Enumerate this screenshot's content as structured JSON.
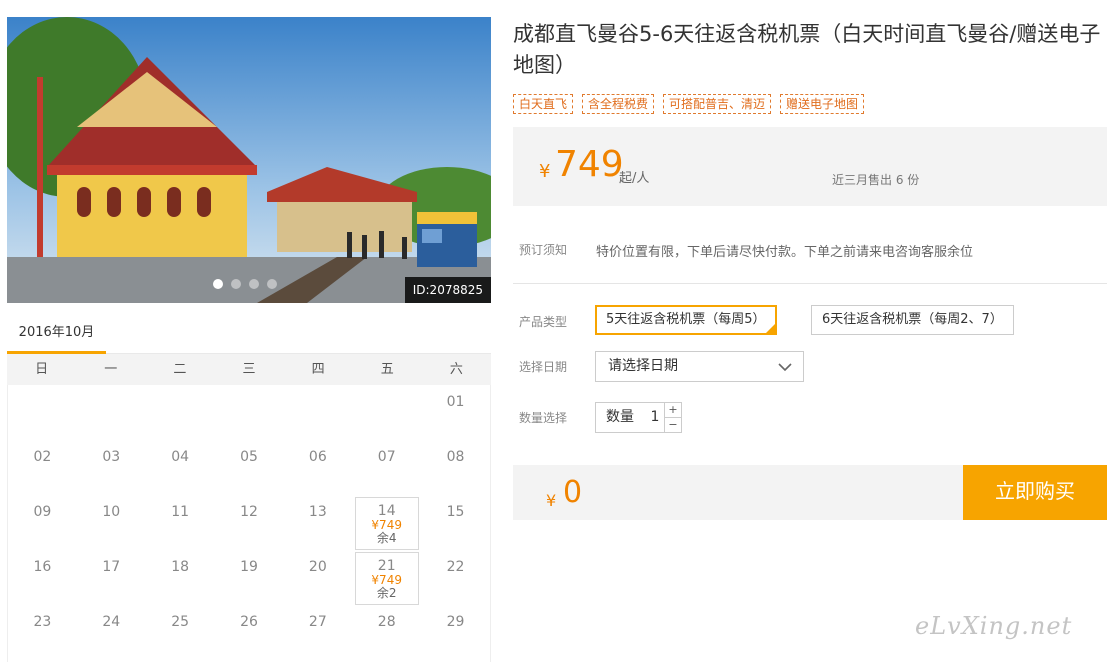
{
  "gallery": {
    "id_label": "ID:2078825",
    "slides": 4,
    "active_slide": 1
  },
  "calendar": {
    "month_label": "2016年10月",
    "weekdays": [
      "日",
      "一",
      "二",
      "三",
      "四",
      "五",
      "六"
    ],
    "leading_blanks": 6,
    "days": [
      {
        "d": "01"
      },
      {
        "d": "02"
      },
      {
        "d": "03"
      },
      {
        "d": "04"
      },
      {
        "d": "05"
      },
      {
        "d": "06"
      },
      {
        "d": "07"
      },
      {
        "d": "08"
      },
      {
        "d": "09"
      },
      {
        "d": "10"
      },
      {
        "d": "11"
      },
      {
        "d": "12"
      },
      {
        "d": "13"
      },
      {
        "d": "14",
        "price": "¥749",
        "stock": "余4"
      },
      {
        "d": "15"
      },
      {
        "d": "16"
      },
      {
        "d": "17"
      },
      {
        "d": "18"
      },
      {
        "d": "19"
      },
      {
        "d": "20"
      },
      {
        "d": "21",
        "price": "¥749",
        "stock": "余2"
      },
      {
        "d": "22"
      },
      {
        "d": "23"
      },
      {
        "d": "24"
      },
      {
        "d": "25"
      },
      {
        "d": "26"
      },
      {
        "d": "27"
      },
      {
        "d": "28"
      },
      {
        "d": "29"
      }
    ]
  },
  "product": {
    "title": "成都直飞曼谷5-6天往返含税机票（白天时间直飞曼谷/赠送电子地图）",
    "tags": [
      "白天直飞",
      "含全程税费",
      "可搭配普吉、清迈",
      "赠送电子地图"
    ],
    "price_currency": "¥",
    "price": "749",
    "price_unit": "起/人",
    "sold_text": "近三月售出 6 份"
  },
  "booking": {
    "notice_label": "预订须知",
    "notice_text": "特价位置有限，下单后请尽快付款。下单之前请来电咨询客服余位",
    "type_label": "产品类型",
    "type_options": [
      "5天往返含税机票（每周5）",
      "6天往返含税机票（每周2、7）"
    ],
    "selected_type": 0,
    "date_label": "选择日期",
    "date_placeholder": "请选择日期",
    "qty_label": "数量选择",
    "qty_inner_label": "数量",
    "qty_value": "1",
    "qty_plus": "+",
    "qty_minus": "−"
  },
  "buy": {
    "currency": "¥",
    "total": "0",
    "button_label": "立即购买"
  },
  "watermark": "eLvXing.net",
  "colors": {
    "accent": "#f7a400",
    "price": "#f08300",
    "tag_border": "#e07a2e"
  }
}
